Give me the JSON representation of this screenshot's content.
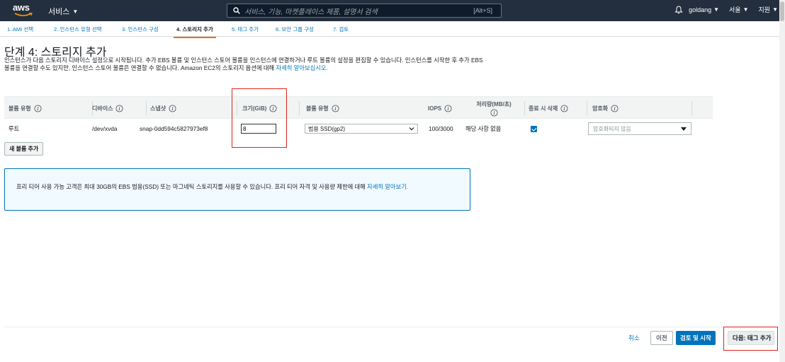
{
  "topnav": {
    "logo": "aws",
    "services_label": "서비스",
    "search_placeholder": "서비스, 기능, 마켓플레이스 제품, 설명서 검색",
    "search_shortcut": "[Alt+S]",
    "user": "goldang",
    "region": "서울",
    "support": "지원"
  },
  "steps": [
    {
      "label": "1. AMI 선택"
    },
    {
      "label": "2. 인스턴스 유형 선택"
    },
    {
      "label": "3. 인스턴스 구성"
    },
    {
      "label": "4. 스토리지 추가"
    },
    {
      "label": "5. 태그 추가"
    },
    {
      "label": "6. 보안 그룹 구성"
    },
    {
      "label": "7. 검토"
    }
  ],
  "page": {
    "title": "단계 4: 스토리지 추가",
    "description_1": "인스턴스가 다음 스토리지 디바이스 설정으로 시작됩니다. 추가 EBS 볼륨 및 인스턴스 스토어 볼륨을 인스턴스에 연결하거나 루트 볼륨의 설정을 편집할 수 있습니다. 인스턴스를 시작한 후 추가 EBS 볼륨을 연결할 수도 있지만, 인스턴스 스토어 볼륨은 연결할 수 없습니다. Amazon EC2의 스토리지 옵션에 대해 ",
    "description_link": "자세히 알아보십시오."
  },
  "table": {
    "headers": {
      "volume_type": "볼륨 유형",
      "device": "디바이스",
      "snapshot": "스냅샷",
      "size": "크기(GiB)",
      "ebs_type": "볼륨 유형",
      "iops": "IOPS",
      "throughput": "처리량(MB/초)",
      "delete_on_term": "종료 시 삭제",
      "encryption": "암호화"
    },
    "row": {
      "volume_type": "루트",
      "device": "/dev/xvda",
      "snapshot": "snap-0dd594c5827973ef8",
      "size": "8",
      "ebs_type": "범용 SSD(gp2)",
      "iops": "100/3000",
      "throughput": "해당 사항 없음",
      "delete_on_term": true,
      "encryption": "암호화되지 않음"
    },
    "add_volume": "새 볼륨 추가"
  },
  "infobox": {
    "text": "프리 티어 사용 가능 고객은 최대 30GB의 EBS 범용(SSD) 또는 마그네틱 스토리지를 사용할 수 있습니다. 프리 티어 자격 및 사용량 제한에 대해 ",
    "link": "자세히 알아보기."
  },
  "footer": {
    "cancel": "취소",
    "previous": "이전",
    "review_launch": "검토 및 시작",
    "next": "다음: 태그 추가"
  },
  "colors": {
    "nav_bg": "#232f3e",
    "link": "#0073bb",
    "primary_button": "#0073bb",
    "active_tab_underline": "#ec7211",
    "highlight_box": "#e0241b"
  }
}
